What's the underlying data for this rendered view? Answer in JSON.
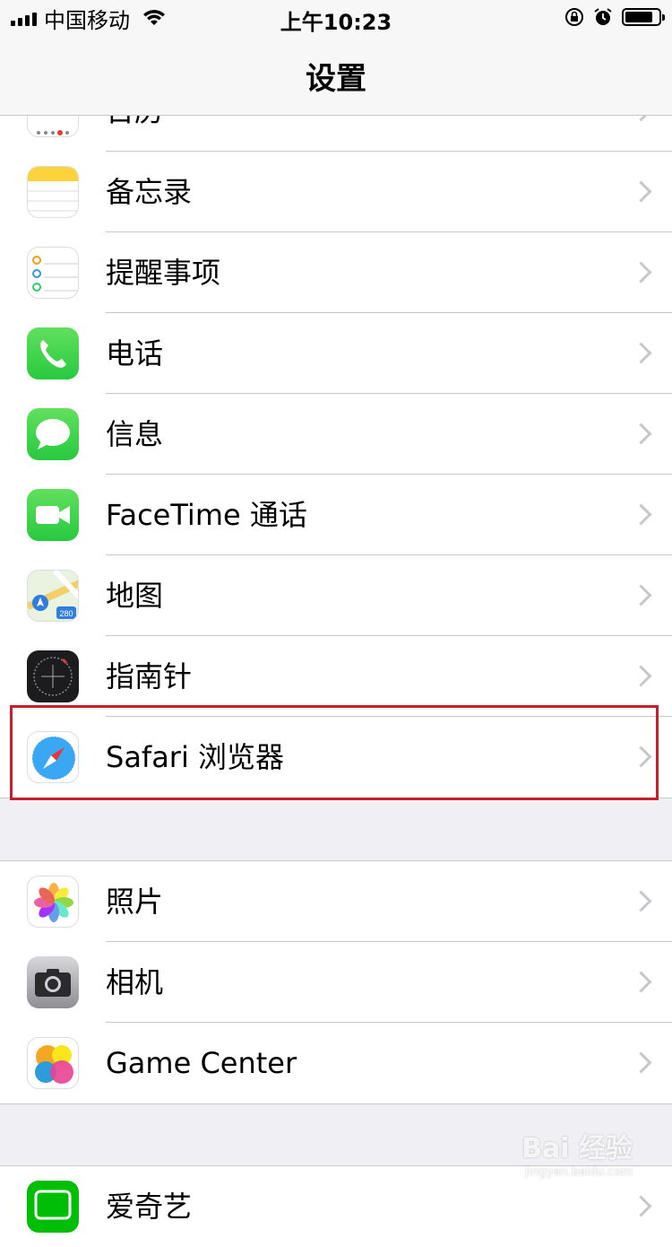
{
  "status_bar": {
    "carrier": "中国移动",
    "time": "上午10:23"
  },
  "nav": {
    "title": "设置"
  },
  "group1": [
    {
      "label": "日历",
      "icon": "calendar-icon"
    },
    {
      "label": "备忘录",
      "icon": "notes-icon"
    },
    {
      "label": "提醒事项",
      "icon": "reminders-icon"
    },
    {
      "label": "电话",
      "icon": "phone-icon"
    },
    {
      "label": "信息",
      "icon": "messages-icon"
    },
    {
      "label": "FaceTime 通话",
      "icon": "facetime-icon"
    },
    {
      "label": "地图",
      "icon": "maps-icon"
    },
    {
      "label": "指南针",
      "icon": "compass-icon"
    },
    {
      "label": "Safari 浏览器",
      "icon": "safari-icon"
    }
  ],
  "group2": [
    {
      "label": "照片",
      "icon": "photos-icon"
    },
    {
      "label": "相机",
      "icon": "camera-icon"
    },
    {
      "label": "Game Center",
      "icon": "game-center-icon"
    }
  ],
  "group3": [
    {
      "label": "爱奇艺",
      "icon": "iqiyi-icon"
    }
  ],
  "maps_badge": "280",
  "watermark": {
    "brand": "Bai 经验",
    "url": "jingyan.baidu.com"
  },
  "colors": {
    "highlight": "#c81e2a",
    "separator": "#c8c7cc",
    "background": "#efeff4"
  }
}
